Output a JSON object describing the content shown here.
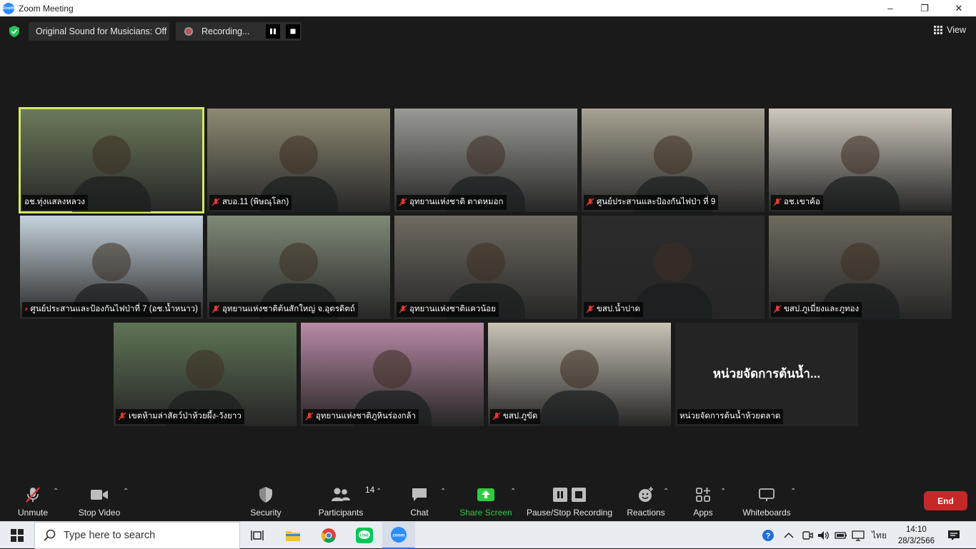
{
  "window": {
    "title": "Zoom Meeting",
    "controls": {
      "minimize": "–",
      "maximize": "❐",
      "close": "✕"
    }
  },
  "topbar": {
    "original_sound": "Original Sound for Musicians: Off",
    "recording": "Recording...",
    "view": "View"
  },
  "participants": [
    {
      "name": "อช.ทุ่งแสลงหลวง",
      "muted": false,
      "active": true,
      "bg": "#6d7a5c"
    },
    {
      "name": "สบอ.11 (พิษณุโลก)",
      "muted": true,
      "bg": "#8f8a74"
    },
    {
      "name": "อุทยานแห่งชาติ ตาดหมอก",
      "muted": true,
      "bg": "#9a9a95"
    },
    {
      "name": "ศูนย์ประสานและป้องกันไฟป่า ที่ 9",
      "muted": true,
      "bg": "#a8a393"
    },
    {
      "name": "อช.เขาค้อ",
      "muted": true,
      "bg": "#cfc8bd"
    },
    {
      "name": "ศูนย์ประสานและป้องกันไฟป่าที่ 7 (อช.น้ำหนาว)",
      "muted": true,
      "bg": "#c6d3dc"
    },
    {
      "name": "อุทยานแห่งชาติต้นสักใหญ่ จ.อุตรดิตถ์",
      "muted": true,
      "bg": "#7f8a77"
    },
    {
      "name": "อุทยานแห่งชาติแควน้อย",
      "muted": true,
      "bg": "#6f6a60"
    },
    {
      "name": "ขสป.น้ำปาด",
      "muted": true,
      "bg": "#2b2b2b"
    },
    {
      "name": "ขสป.ภูเมี่ยงและภูทอง",
      "muted": true,
      "bg": "#6e6a5e"
    },
    {
      "name": "เขตห้ามล่าสัตว์ป่าห้วยผึ้ง-วังยาว",
      "muted": true,
      "bg": "#5f7456"
    },
    {
      "name": "อุทยานแห่งชาติภูหินร่องกล้า",
      "muted": true,
      "bg": "#b98aa6"
    },
    {
      "name": "ขสป.ภูขัด",
      "muted": true,
      "bg": "#c9c3b6"
    },
    {
      "name": "หน่วยจัดการต้นน้ำห้วยตลาด",
      "muted": false,
      "video_off": true,
      "big_label": "หน่วยจัดการต้นน้ำ...",
      "bg": "#242424"
    }
  ],
  "toolbar": {
    "unmute": "Unmute",
    "stop_video": "Stop Video",
    "security": "Security",
    "participants": "Participants",
    "participants_count": "14",
    "chat": "Chat",
    "share_screen": "Share Screen",
    "pause_stop_recording": "Pause/Stop Recording",
    "reactions": "Reactions",
    "apps": "Apps",
    "whiteboards": "Whiteboards",
    "end": "End",
    "share_color": "#2ecc40",
    "end_color": "#c62828"
  },
  "taskbar": {
    "search_placeholder": "Type here to search",
    "time": "14:10",
    "date": "28/3/2566",
    "language": "ไทย"
  }
}
